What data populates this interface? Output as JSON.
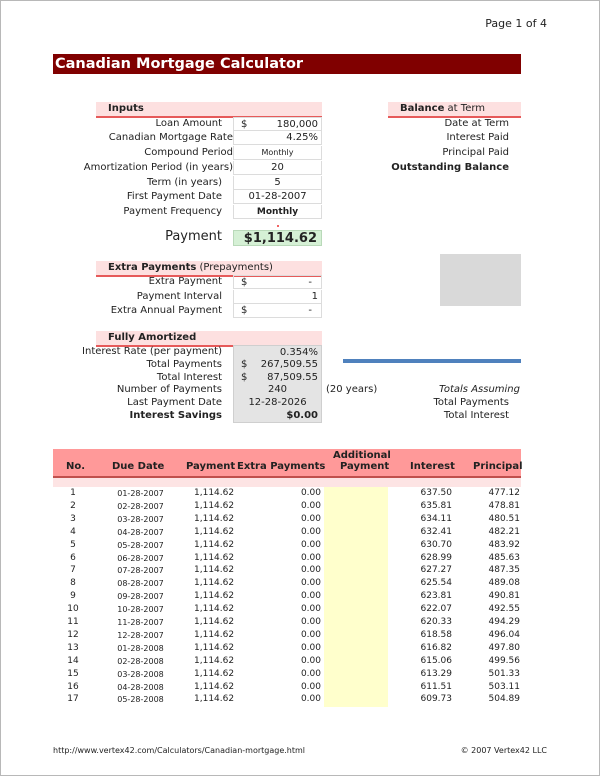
{
  "page": {
    "label": "Page 1 of 4"
  },
  "title": "Canadian Mortgage Calculator",
  "inputs": {
    "header": "Inputs",
    "rows": [
      {
        "label": "Loan Amount",
        "currency": "$",
        "value": "180,000"
      },
      {
        "label": "Canadian Mortgage Rate",
        "value": "4.25%"
      },
      {
        "label": "Compound Period",
        "value": "Monthly"
      },
      {
        "label": "Amortization Period (in years)",
        "value": "20"
      },
      {
        "label": "Term (in years)",
        "value": "5"
      },
      {
        "label": "First Payment Date",
        "value": "01-28-2007"
      },
      {
        "label": "Payment Frequency",
        "value": "Monthly"
      }
    ]
  },
  "payment": {
    "label": "Payment",
    "value": "$1,114.62"
  },
  "balance": {
    "header_bold": "Balance",
    "header_rest": " at Term",
    "rows": [
      "Date at Term",
      "Interest Paid",
      "Principal Paid",
      "Outstanding Balance"
    ]
  },
  "extra": {
    "header_bold": "Extra Payments",
    "header_rest": " (Prepayments)",
    "rows": [
      {
        "label": "Extra Payment",
        "currency": "$",
        "value": "-"
      },
      {
        "label": "Payment Interval",
        "value": "1"
      },
      {
        "label": "Extra Annual Payment",
        "currency": "$",
        "value": "-"
      }
    ]
  },
  "amortized": {
    "header": "Fully Amortized",
    "rows": [
      {
        "label": "Interest Rate (per payment)",
        "value": "0.354%"
      },
      {
        "label": "Total Payments",
        "currency": "$",
        "value": "267,509.55"
      },
      {
        "label": "Total Interest",
        "currency": "$",
        "value": "87,509.55"
      },
      {
        "label": "Number of Payments",
        "value": "240",
        "note": "(20 years)"
      },
      {
        "label": "Last Payment Date",
        "value": "12-28-2026"
      },
      {
        "label": "Interest Savings",
        "value": "$0.00"
      }
    ]
  },
  "totals_assuming": {
    "title": "Totals Assuming",
    "rows": [
      "Total Payments",
      "Total Interest"
    ]
  },
  "schedule": {
    "columns": [
      "No.",
      "Due Date",
      "Payment",
      "Extra Payments",
      "Additional",
      "Payment",
      "Interest",
      "Principal"
    ],
    "rows": [
      [
        "1",
        "01-28-2007",
        "1,114.62",
        "0.00",
        "637.50",
        "477.12"
      ],
      [
        "2",
        "02-28-2007",
        "1,114.62",
        "0.00",
        "635.81",
        "478.81"
      ],
      [
        "3",
        "03-28-2007",
        "1,114.62",
        "0.00",
        "634.11",
        "480.51"
      ],
      [
        "4",
        "04-28-2007",
        "1,114.62",
        "0.00",
        "632.41",
        "482.21"
      ],
      [
        "5",
        "05-28-2007",
        "1,114.62",
        "0.00",
        "630.70",
        "483.92"
      ],
      [
        "6",
        "06-28-2007",
        "1,114.62",
        "0.00",
        "628.99",
        "485.63"
      ],
      [
        "7",
        "07-28-2007",
        "1,114.62",
        "0.00",
        "627.27",
        "487.35"
      ],
      [
        "8",
        "08-28-2007",
        "1,114.62",
        "0.00",
        "625.54",
        "489.08"
      ],
      [
        "9",
        "09-28-2007",
        "1,114.62",
        "0.00",
        "623.81",
        "490.81"
      ],
      [
        "10",
        "10-28-2007",
        "1,114.62",
        "0.00",
        "622.07",
        "492.55"
      ],
      [
        "11",
        "11-28-2007",
        "1,114.62",
        "0.00",
        "620.33",
        "494.29"
      ],
      [
        "12",
        "12-28-2007",
        "1,114.62",
        "0.00",
        "618.58",
        "496.04"
      ],
      [
        "13",
        "01-28-2008",
        "1,114.62",
        "0.00",
        "616.82",
        "497.80"
      ],
      [
        "14",
        "02-28-2008",
        "1,114.62",
        "0.00",
        "615.06",
        "499.56"
      ],
      [
        "15",
        "03-28-2008",
        "1,114.62",
        "0.00",
        "613.29",
        "501.33"
      ],
      [
        "16",
        "04-28-2008",
        "1,114.62",
        "0.00",
        "611.51",
        "503.11"
      ],
      [
        "17",
        "05-28-2008",
        "1,114.62",
        "0.00",
        "609.73",
        "504.89"
      ]
    ]
  },
  "footer": {
    "url": "http://www.vertex42.com/Calculators/Canadian-mortgage.html",
    "copyright": "© 2007 Vertex42 LLC"
  },
  "colors": {
    "title_bg": "#800000",
    "section_bg": "#fde0e0",
    "section_rule": "#e65a5a",
    "payment_bg": "#d5f0d5",
    "table_header_bg": "#ff9999",
    "additional_col_bg": "#ffffcc",
    "separator_line": "#4f81bd"
  }
}
